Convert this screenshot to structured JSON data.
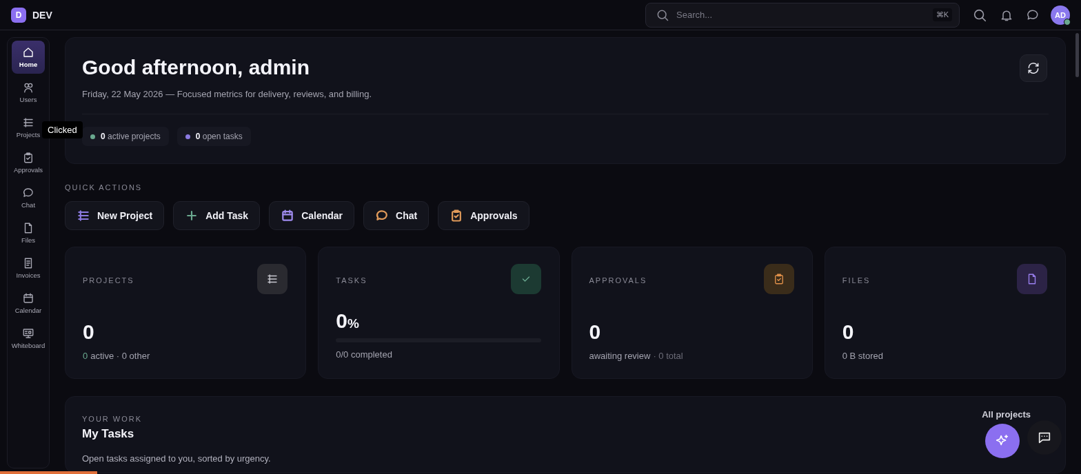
{
  "topbar": {
    "logo": "D",
    "brand": "DEV",
    "search": {
      "placeholder": "Search...",
      "shortcut": "⌘K"
    },
    "avatar": "AD"
  },
  "sidebar": {
    "items": [
      {
        "label": "Home",
        "selected": true
      },
      {
        "label": "Users",
        "selected": false
      },
      {
        "label": "Projects",
        "selected": false
      },
      {
        "label": "Approvals",
        "selected": false
      },
      {
        "label": "Chat",
        "selected": false
      },
      {
        "label": "Files",
        "selected": false
      },
      {
        "label": "Invoices",
        "selected": false
      },
      {
        "label": "Calendar",
        "selected": false
      },
      {
        "label": "Whiteboard",
        "selected": false
      }
    ],
    "tooltip": "Clicked"
  },
  "hero": {
    "title": "Good afternoon, admin",
    "subtitle": "Friday, 22 May 2026 — Focused metrics for delivery, reviews, and billing.",
    "chips": [
      {
        "text": "**0** active projects",
        "color": "#6aa88f"
      },
      {
        "text": "**0** open tasks",
        "color": "#8b7ae0"
      }
    ]
  },
  "quick_actions": {
    "heading": "QUICK ACTIONS",
    "buttons": [
      {
        "label": "New Project",
        "color": "#8b7ae0"
      },
      {
        "label": "Add Task",
        "color": "#6aa88f"
      },
      {
        "label": "Calendar",
        "color": "#a08cf0"
      },
      {
        "label": "Chat",
        "color": "#e09a5a"
      },
      {
        "label": "Approvals",
        "color": "#e09a5a"
      }
    ]
  },
  "stats": [
    {
      "kind": "count",
      "label": "PROJECTS",
      "value": "0",
      "color": "#2a2a30",
      "details": [
        {
          "text": "0",
          "color": "#6aa88f"
        },
        {
          "text": "active · 0 other",
          "color": "#a4a4b0"
        }
      ]
    },
    {
      "kind": "progress",
      "label": "TASKS",
      "value": "0",
      "unit": "%",
      "color": "#1c3a32",
      "details": [
        {
          "text": "0/0 completed",
          "color": "#a4a4b0"
        }
      ]
    },
    {
      "kind": "count",
      "label": "APPROVALS",
      "value": "0",
      "color": "#3a2c1a",
      "details": [
        {
          "text": "awaiting review",
          "color": "#a4a4b0"
        },
        {
          "text": "· 0 total",
          "color": "#6c6c78"
        }
      ]
    },
    {
      "kind": "count",
      "label": "FILES",
      "value": "0",
      "color": "#2c2346",
      "details": [
        {
          "text": "0 B stored",
          "color": "#a4a4b0"
        }
      ]
    }
  ],
  "work": {
    "eyebrow": "YOUR WORK",
    "title": "My Tasks",
    "subtitle": "Open tasks assigned to you, sorted by urgency.",
    "link": "All projects"
  },
  "page_progress": {
    "level": 0.09
  }
}
